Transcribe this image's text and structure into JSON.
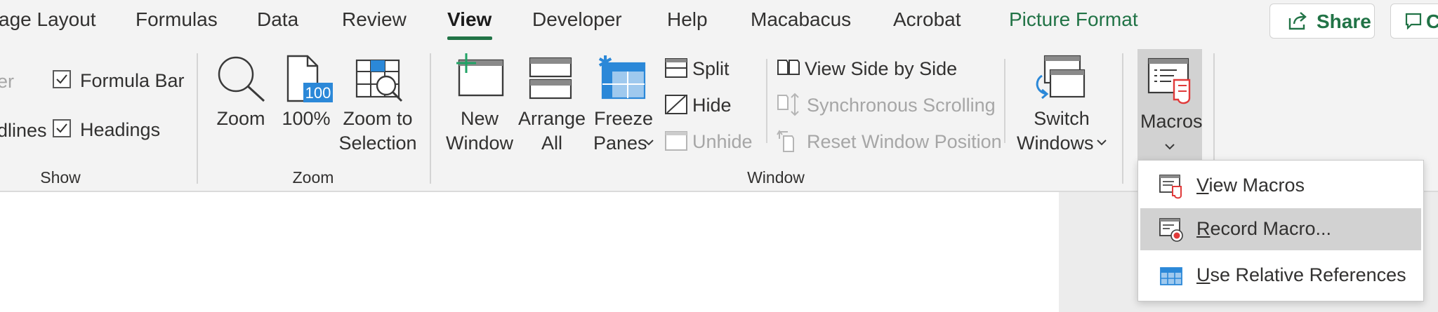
{
  "tabs": [
    {
      "label": "age Layout"
    },
    {
      "label": "Formulas"
    },
    {
      "label": "Data"
    },
    {
      "label": "Review"
    },
    {
      "label": "View",
      "active": true
    },
    {
      "label": "Developer"
    },
    {
      "label": "Help"
    },
    {
      "label": "Macabacus"
    },
    {
      "label": "Acrobat"
    },
    {
      "label": "Picture Format"
    }
  ],
  "share_label": "Share",
  "comments_label": "C",
  "show_group": {
    "label": "Show",
    "partial_ruler": "er",
    "partial_gridlines": "dlines",
    "formula_bar": "Formula Bar",
    "formula_bar_checked": true,
    "headings": "Headings",
    "headings_checked": true
  },
  "zoom_group": {
    "label": "Zoom",
    "zoom": "Zoom",
    "hundred": "100%",
    "hundred_badge": "100",
    "zoom_to_selection_1": "Zoom to",
    "zoom_to_selection_2": "Selection"
  },
  "window_group": {
    "label": "Window",
    "new_window_1": "New",
    "new_window_2": "Window",
    "arrange_all_1": "Arrange",
    "arrange_all_2": "All",
    "freeze_panes_1": "Freeze",
    "freeze_panes_2": "Panes",
    "split": "Split",
    "hide": "Hide",
    "unhide": "Unhide",
    "view_side_by_side": "View Side by Side",
    "synchronous_scrolling": "Synchronous Scrolling",
    "reset_window_position": "Reset Window Position",
    "switch_windows_1": "Switch",
    "switch_windows_2": "Windows"
  },
  "macros": {
    "label": "Macros",
    "menu": [
      {
        "label_first": "V",
        "label_rest": "iew Macros"
      },
      {
        "label_first": "R",
        "label_rest": "ecord Macro..."
      },
      {
        "label_first": "U",
        "label_rest": "se Relative References"
      }
    ]
  },
  "colors": {
    "accent_green": "#217346",
    "blue_icon": "#2b88d8",
    "red_icon": "#e03a3a"
  }
}
